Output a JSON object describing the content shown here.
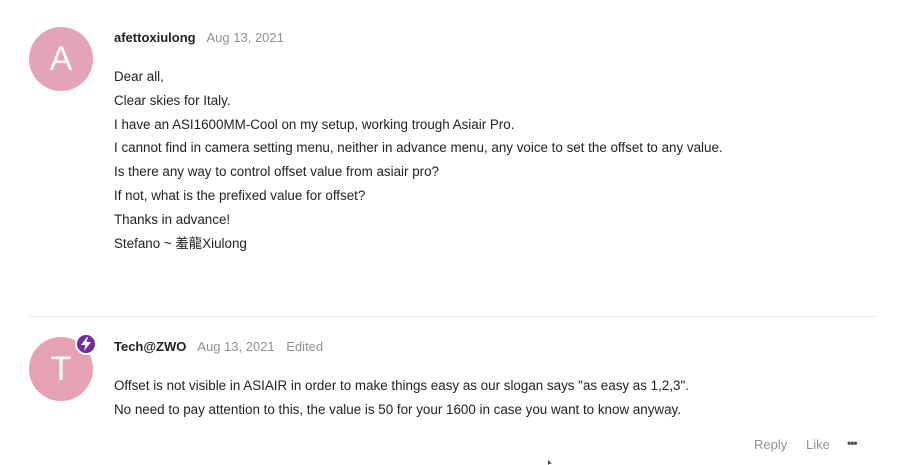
{
  "posts": [
    {
      "avatar_letter": "A",
      "avatar_color": "#e5a2bb",
      "username": "afettoxiulong",
      "date": "Aug 13, 2021",
      "lines": [
        "Dear all,",
        "Clear skies for Italy.",
        "I have an ASI1600MM-Cool on my setup, working trough Asiair Pro.",
        "I cannot find in camera setting menu, neither in advance menu, any voice to set the offset to any value.",
        "Is there any way to control offset value from asiair pro?",
        "If not, what is the prefixed value for offset?",
        "Thanks in advance!",
        "Stefano ~ 羞龍Xiulong"
      ]
    },
    {
      "avatar_letter": "T",
      "avatar_color": "#e5a2b3",
      "badge_color": "#6f2d9d",
      "badge_icon": "lightning-bolt-icon",
      "username": "Tech@ZWO",
      "date": "Aug 13, 2021",
      "edited": "Edited",
      "lines": [
        "Offset is not visible in ASIAIR in order to make things easy as our slogan says \"as easy as 1,2,3\".",
        "No need to pay attention to this, the value is 50 for your 1600 in case you want to know anyway."
      ]
    }
  ],
  "actions": {
    "reply": "Reply",
    "like": "Like",
    "more": "•••"
  }
}
